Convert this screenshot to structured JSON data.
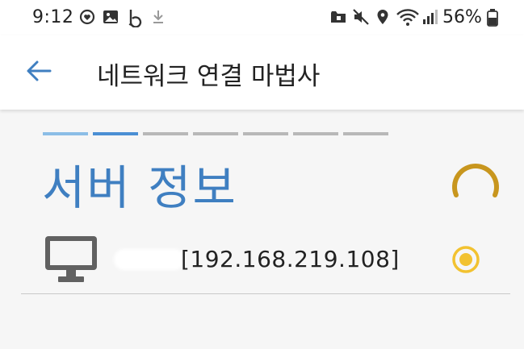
{
  "status_bar": {
    "time": "9:12",
    "battery": "56%",
    "left_icons": [
      "heart-sync-icon",
      "image-icon",
      "b-app-icon",
      "download-icon"
    ],
    "right_icons": [
      "folder-lock-icon",
      "mute-icon",
      "location-icon",
      "wifi-icon",
      "signal-icon",
      "battery-icon"
    ]
  },
  "app_bar": {
    "title": "네트워크 연결 마법사",
    "back_icon": "arrow-left-icon"
  },
  "wizard": {
    "total_steps": 7,
    "current_step": 2,
    "title": "서버 정보",
    "loading": true
  },
  "server": {
    "address": "[192.168.219.108]",
    "icon": "monitor-icon",
    "selected": true
  },
  "colors": {
    "accent": "#3f7fc1",
    "step_active": "#4b8fd4",
    "step_done": "#8bbde6",
    "step_pending": "#b8b8b8",
    "spinner": "#c8961e",
    "radio": "#f2c230"
  }
}
